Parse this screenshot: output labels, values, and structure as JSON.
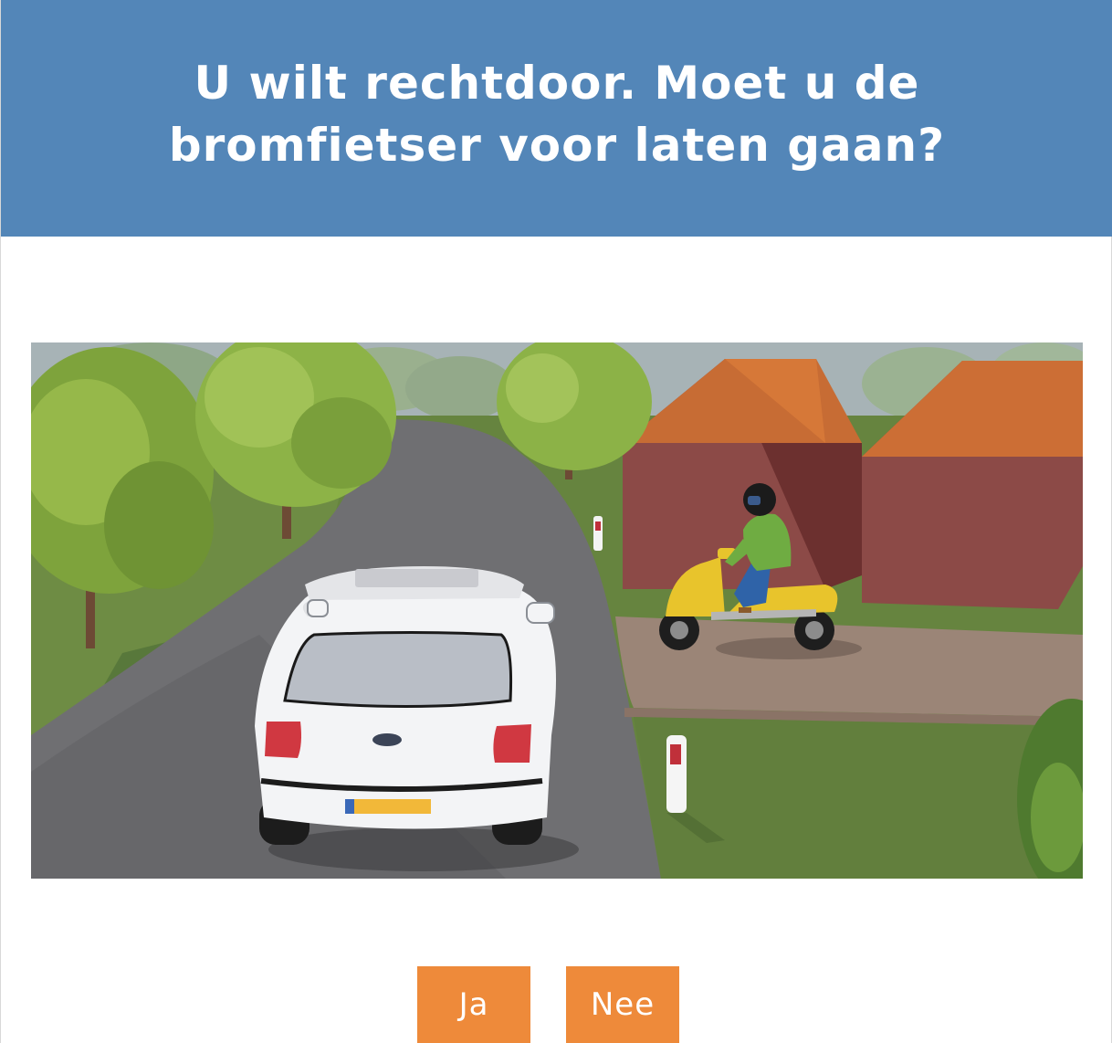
{
  "question": {
    "text": "U wilt rechtdoor. Moet u de bromfietser voor laten gaan?"
  },
  "answers": [
    {
      "label": "Ja"
    },
    {
      "label": "Nee"
    }
  ],
  "colors": {
    "header_background": "#5386b8",
    "button_background": "#ee8a3a",
    "button_text": "#ffffff"
  }
}
